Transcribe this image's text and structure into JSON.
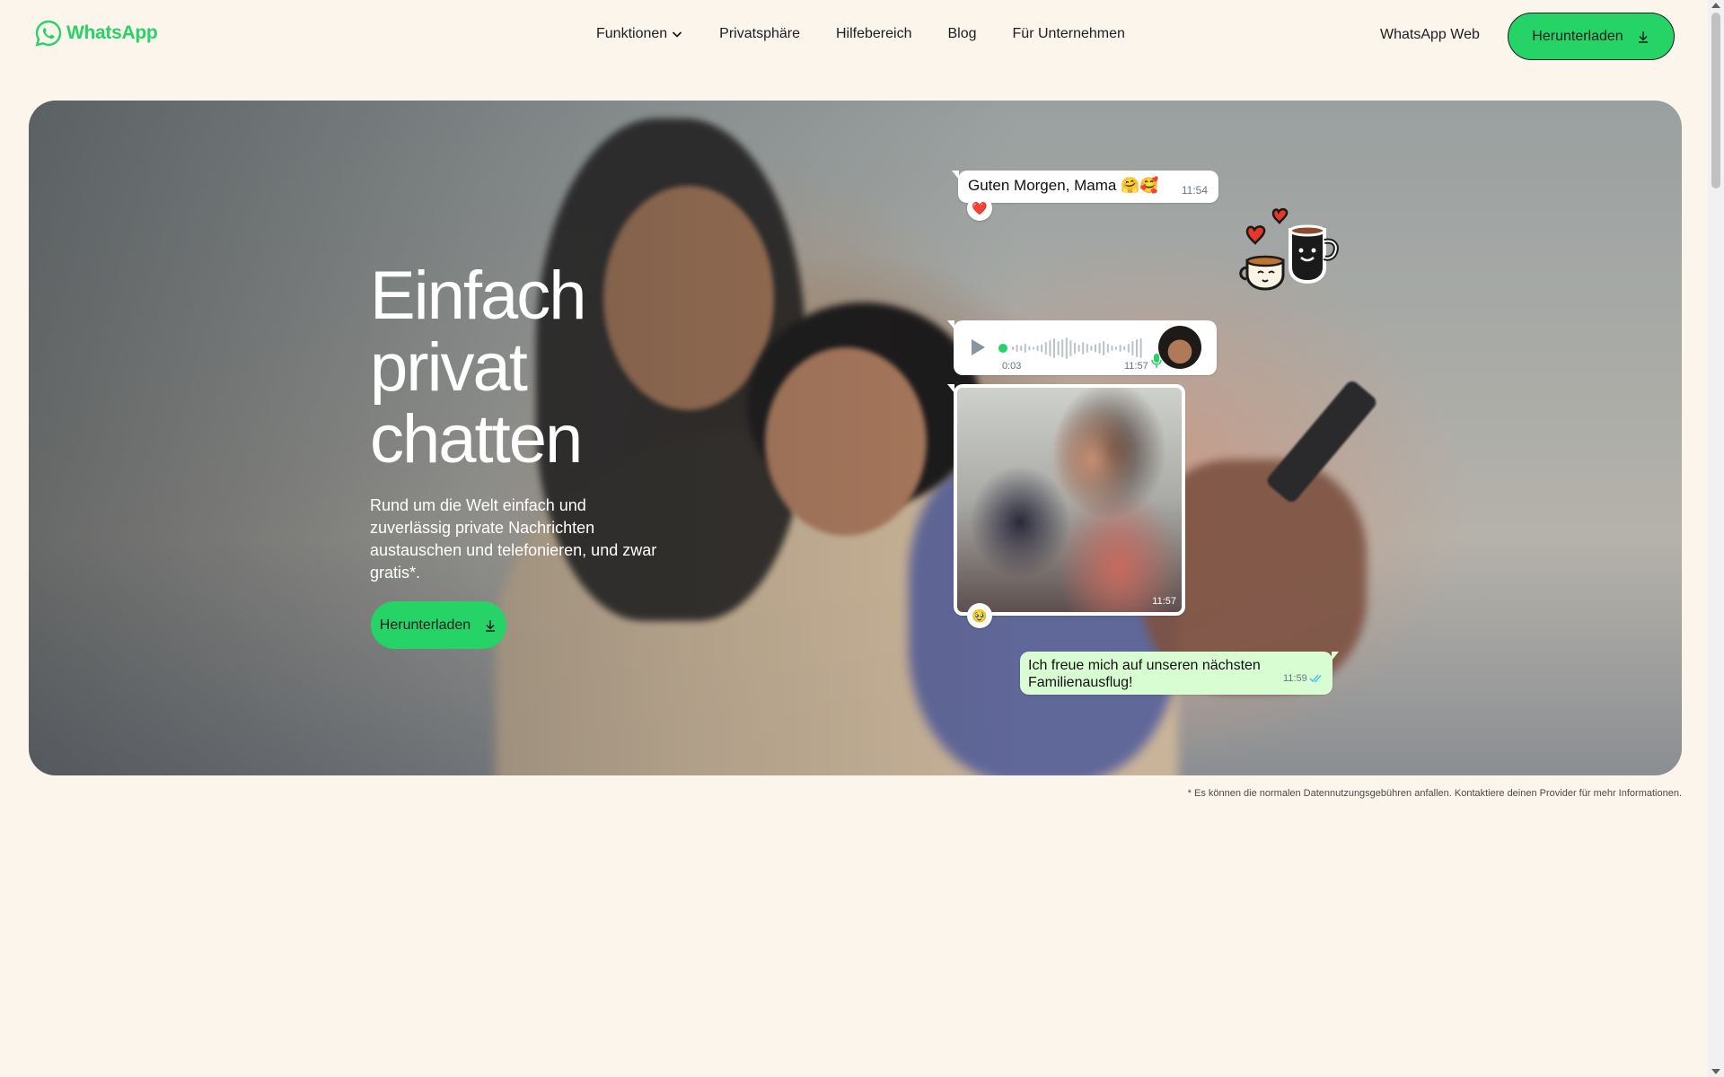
{
  "header": {
    "logo_text": "WhatsApp",
    "nav": [
      {
        "label": "Funktionen",
        "has_dropdown": true
      },
      {
        "label": "Privatsphäre"
      },
      {
        "label": "Hilfebereich"
      },
      {
        "label": "Blog"
      },
      {
        "label": "Für Unternehmen"
      }
    ],
    "web_link": "WhatsApp Web",
    "download_label": "Herunterladen"
  },
  "hero": {
    "title_lines": [
      "Einfach",
      "privat",
      "chatten"
    ],
    "subtitle": "Rund um die Welt einfach und zuverlässig private Nachrichten austauschen und telefonieren, und zwar gratis*.",
    "download_label": "Herunterladen"
  },
  "chat": {
    "msg1": {
      "text": "Guten Morgen, Mama 🤗🥰",
      "time": "11:54",
      "reaction": "❤️"
    },
    "voice": {
      "duration": "0:03",
      "time": "11:57"
    },
    "photo": {
      "time": "11:57",
      "reaction": "🥹"
    },
    "msg2": {
      "text": "Ich freue mich auf unseren nächsten Familienausflug!",
      "time": "11:59"
    }
  },
  "footnote": "* Es können die normalen Datennutzungsgebühren anfallen. Kontaktiere deinen Provider für mehr Informationen.",
  "colors": {
    "brand_green": "#25d366",
    "background": "#fcf5eb",
    "outgoing_bubble": "#d9fdd3",
    "read_ticks": "#53bdeb"
  },
  "icons": [
    "whatsapp-logo-icon",
    "chevron-down-icon",
    "download-icon",
    "play-icon",
    "microphone-icon",
    "double-check-icon",
    "coffee-cups-sticker"
  ]
}
